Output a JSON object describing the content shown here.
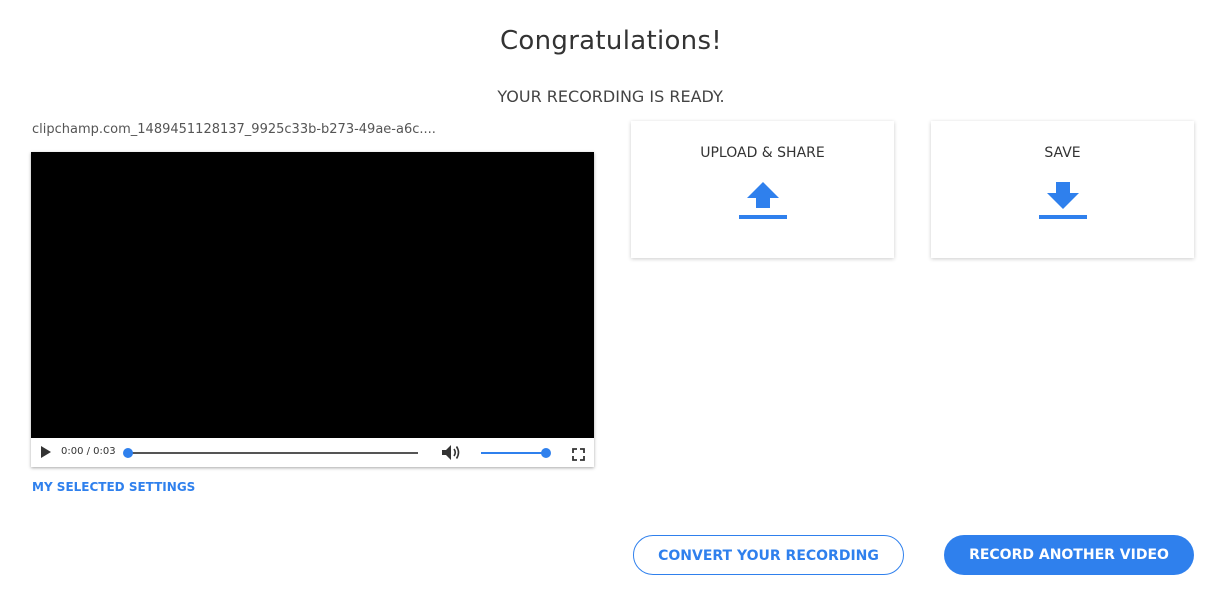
{
  "header": {
    "title": "Congratulations!",
    "subtitle": "YOUR RECORDING IS READY."
  },
  "video": {
    "filename": "clipchamp.com_1489451128137_9925c33b-b273-49ae-a6c....",
    "time": "0:00 / 0:03",
    "progress": 0.0,
    "volume": 1.0
  },
  "settings_link": "MY SELECTED SETTINGS",
  "cards": {
    "upload_label": "UPLOAD & SHARE",
    "save_label": "SAVE",
    "upload_icon": "upload-arrow-icon",
    "save_icon": "download-arrow-icon"
  },
  "actions": {
    "convert_label": "CONVERT YOUR RECORDING",
    "record_label": "RECORD ANOTHER VIDEO"
  },
  "colors": {
    "accent": "#2f80ed",
    "text": "#333333"
  }
}
